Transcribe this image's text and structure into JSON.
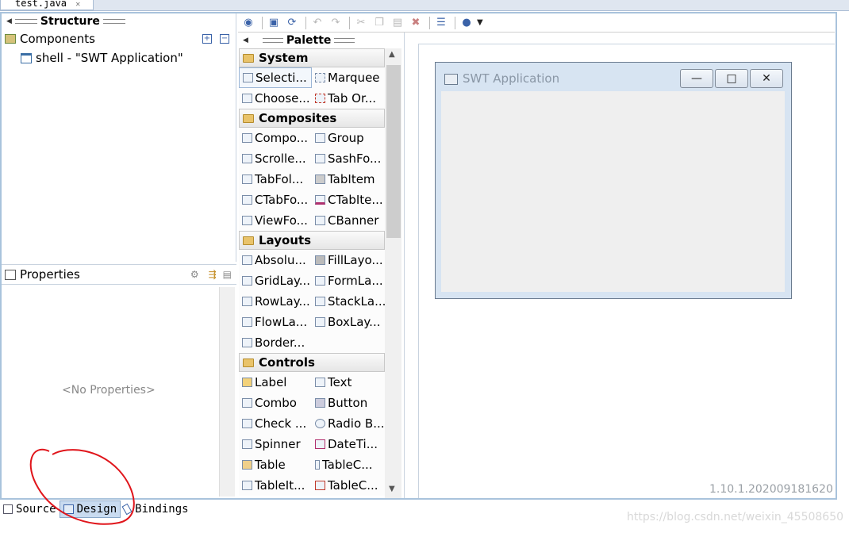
{
  "editor_tab": {
    "label": "test.java"
  },
  "structure": {
    "title": "Structure",
    "components_label": "Components",
    "tree_item": "shell - \"SWT Application\""
  },
  "properties": {
    "title": "Properties",
    "empty": "<No Properties>"
  },
  "palette": {
    "title": "Palette",
    "categories": [
      {
        "name": "System",
        "items": [
          "Selecti...",
          "Marquee",
          "Choose...",
          "Tab Or..."
        ]
      },
      {
        "name": "Composites",
        "items": [
          "Compo...",
          "Group",
          "Scrolle...",
          "SashFo...",
          "TabFol...",
          "TabItem",
          "CTabFo...",
          "CTabIte...",
          "ViewFo...",
          "CBanner"
        ]
      },
      {
        "name": "Layouts",
        "items": [
          "Absolu...",
          "FillLayo...",
          "GridLay...",
          "FormLa...",
          "RowLay...",
          "StackLa...",
          "FlowLa...",
          "BoxLay...",
          "Border..."
        ]
      },
      {
        "name": "Controls",
        "items": [
          "Label",
          "Text",
          "Combo",
          "Button",
          "Check ...",
          "Radio B...",
          "Spinner",
          "DateTi...",
          "Table",
          "TableC...",
          "TableIt...",
          "TableC..."
        ]
      }
    ]
  },
  "swt_window": {
    "title": "SWT Application",
    "minimize": "—",
    "maximize": "□",
    "close": "✕"
  },
  "version": "1.10.1.202009181620",
  "bottom_tabs": {
    "source": "Source",
    "design": "Design",
    "bindings": "Bindings"
  },
  "watermark": "https://blog.csdn.net/weixin_45508650",
  "colors": {
    "accent": "#a9c3dc",
    "annotation": "#e0151b"
  }
}
